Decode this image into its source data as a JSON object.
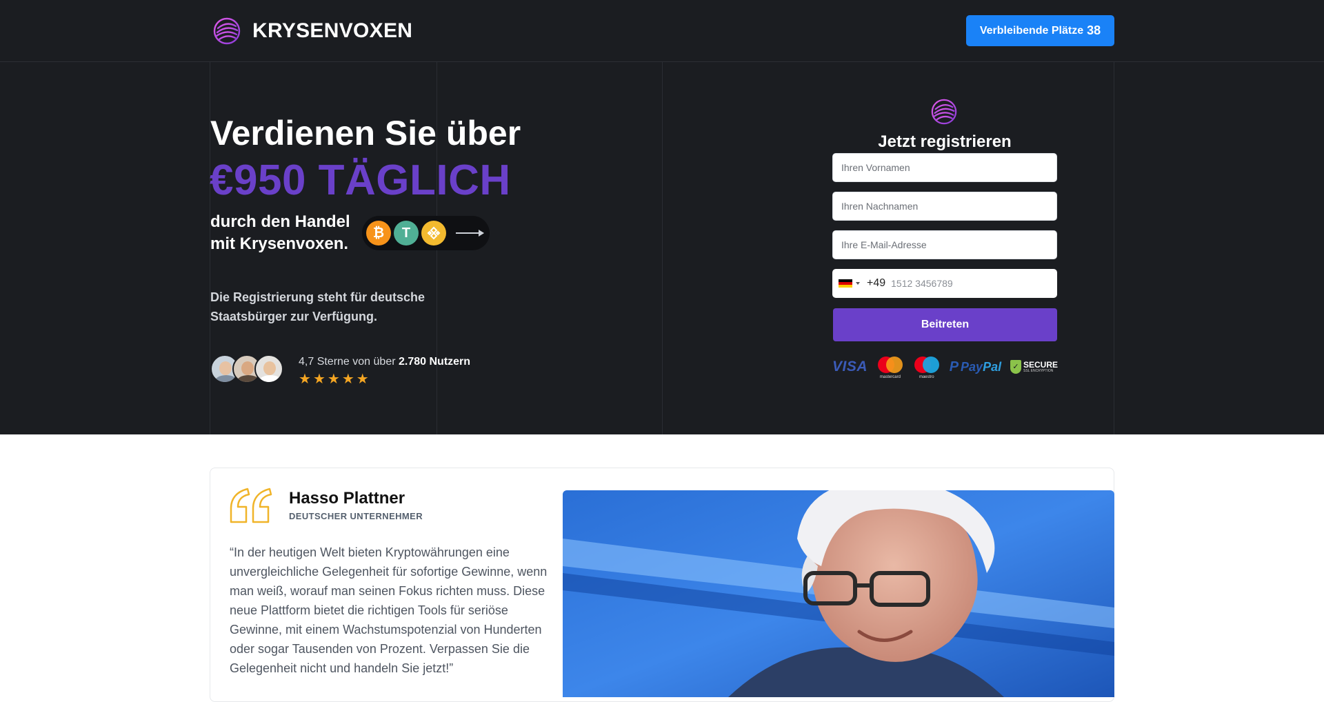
{
  "header": {
    "brand": "KRYSENVOXEN",
    "places_label": "Verbleibende Plätze",
    "places_count": "38"
  },
  "hero": {
    "headline": "Verdienen Sie über",
    "amount": "€950 TÄGLICH",
    "subheadline": "durch den Handel mit Krysenvoxen.",
    "coins": [
      "bitcoin-icon",
      "tether-icon",
      "bnb-icon"
    ],
    "note": "Die Registrierung steht für deutsche Staatsbürger zur Verfügung.",
    "rating_prefix": "4,7 Sterne von über",
    "rating_users": "2.780 Nutzern",
    "stars": 5
  },
  "form": {
    "title": "Jetzt registrieren",
    "first_name_placeholder": "Ihren Vornamen",
    "last_name_placeholder": "Ihren Nachnamen",
    "email_placeholder": "Ihre E-Mail-Adresse",
    "dial_code": "+49",
    "phone_placeholder": "1512 3456789",
    "submit_label": "Beitreten",
    "payments": {
      "visa": "VISA",
      "mastercard": "mastercard",
      "maestro": "maestro",
      "paypal_1": "Pay",
      "paypal_2": "Pal",
      "secure": "SECURE",
      "secure_sub": "SSL ENCRYPTION"
    }
  },
  "testimonial": {
    "name": "Hasso Plattner",
    "role": "DEUTSCHER UNTERNEHMER",
    "quote": "“In der heutigen Welt bieten Kryptowährungen eine unvergleichliche Gelegenheit für sofortige Gewinne, wenn man weiß, worauf man seinen Fokus richten muss. Diese neue Plattform bietet die richtigen Tools für seriöse Gewinne, mit einem Wachstumspotenzial von Hunderten oder sogar Tausenden von Prozent. Verpassen Sie die Gelegenheit nicht und handeln Sie jetzt!”"
  },
  "colors": {
    "accent": "#6a40c9",
    "button_blue": "#1a82f7",
    "dark_bg": "#1b1d21",
    "star": "#f5a623"
  }
}
